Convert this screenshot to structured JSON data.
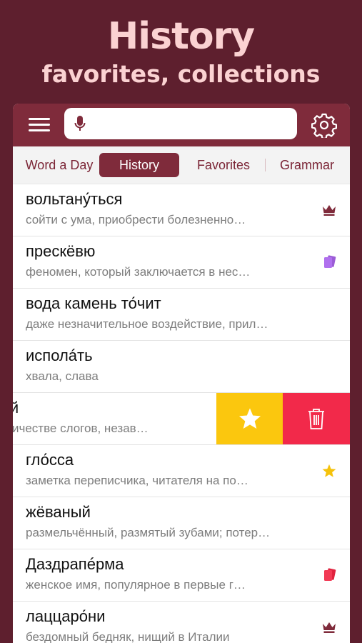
{
  "promo": {
    "title": "History",
    "subtitle": "favorites, collections"
  },
  "search": {
    "value": "",
    "placeholder": ""
  },
  "tabs": [
    {
      "label": "Word a Day"
    },
    {
      "label": "History"
    },
    {
      "label": "Favorites"
    },
    {
      "label": "Grammar"
    }
  ],
  "active_tab": "History",
  "rows": [
    {
      "word": "вольтану́ться",
      "definition": "сойти с ума, приобрести болезненно…",
      "icon": "crown-icon"
    },
    {
      "word": "прескёвю",
      "definition": "феномен, который заключается в нес…",
      "icon": "cards-purple-icon"
    },
    {
      "word": "вода камень то́чит",
      "definition": "даже незначительное воздействие, прил…",
      "icon": ""
    },
    {
      "word": "исполáть",
      "definition": "хвала, слава",
      "icon": ""
    },
    {
      "word": "ый",
      "definition": "оличестве слогов, незав…",
      "icon": ""
    },
    {
      "word": "гло́сса",
      "definition": "заметка переписчика, читателя на по…",
      "icon": "star-icon"
    },
    {
      "word": "жёваный",
      "definition": "размельчённый, размятый зубами; потер…",
      "icon": ""
    },
    {
      "word": "Даздрапéрма",
      "definition": "женское имя, популярное в первые г…",
      "icon": "cards-red-icon"
    },
    {
      "word": "лаццаро́ни",
      "definition": "бездомный бедняк, нищий в Италии",
      "icon": "crown-icon"
    }
  ],
  "colors": {
    "background": "#5e1f2e",
    "topbar": "#7f2b3b",
    "promo_text": "#fbd2d2",
    "favorite_action": "#fbc70e",
    "delete_action": "#f2294a"
  }
}
